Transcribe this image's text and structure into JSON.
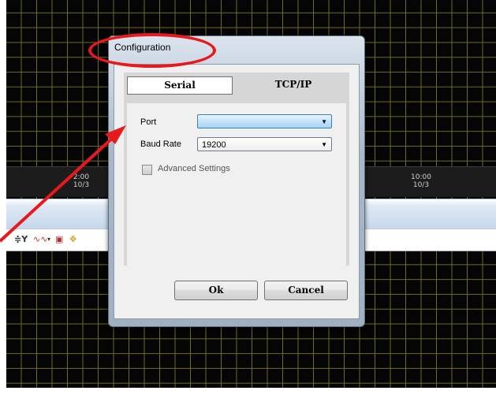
{
  "background": {
    "time_labels": [
      {
        "time": "2:00",
        "date": "10/3"
      },
      {
        "time": "10:00",
        "date": "10/3"
      }
    ],
    "toolbar_icons": [
      "y-axis-icon",
      "waveform-icon",
      "dropdown-icon",
      "panel-icon",
      "pan-icon"
    ]
  },
  "dialog": {
    "title": "Configuration",
    "tabs": [
      {
        "label": "Serial",
        "selected": true
      },
      {
        "label": "TCP/IP",
        "selected": false
      }
    ],
    "port": {
      "label": "Port",
      "value": ""
    },
    "baud_rate": {
      "label": "Baud Rate",
      "value": "19200"
    },
    "advanced_settings": {
      "label": "Advanced Settings",
      "checked": false
    },
    "ok_label": "Ok",
    "cancel_label": "Cancel"
  },
  "colors": {
    "grid": "#6f6c1a",
    "annotation": "#e8191c",
    "port_highlight": "#bfe0f8"
  }
}
